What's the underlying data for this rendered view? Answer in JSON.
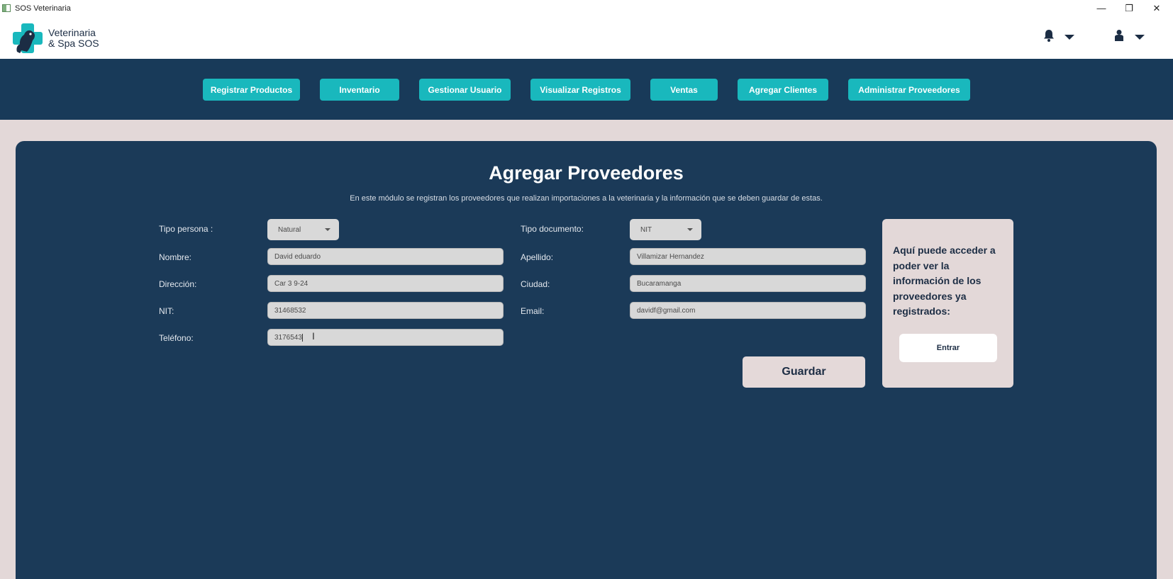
{
  "window": {
    "title": "SOS Veterinaria",
    "controls": {
      "minimize": "—",
      "restore": "❐",
      "close": "✕"
    }
  },
  "header": {
    "logo_line1": "Veterinaria",
    "logo_line2": "& Spa SOS",
    "icons": [
      "bell-icon",
      "user-icon"
    ]
  },
  "nav": {
    "items": [
      "Registrar Productos",
      "Inventario",
      "Gestionar Usuario",
      "Visualizar Registros",
      "Ventas",
      "Agregar Clientes",
      "Administrar Proveedores"
    ]
  },
  "form": {
    "title": "Agregar Proveedores",
    "subtitle": "En este módulo se registran los proveedores que realizan importaciones a la veterinaria y la información que se deben guardar de estas.",
    "tipo_persona": {
      "label": "Tipo persona :",
      "value": "Natural"
    },
    "tipo_documento": {
      "label": "Tipo documento:",
      "value": "NIT"
    },
    "nombre": {
      "label": "Nombre:",
      "value": "David eduardo"
    },
    "apellido": {
      "label": "Apellido:",
      "value": "Villamizar Hernandez"
    },
    "direccion": {
      "label": "Dirección:",
      "value": "Car 3 9-24"
    },
    "ciudad": {
      "label": "Ciudad:",
      "value": "Bucaramanga"
    },
    "nit": {
      "label": "NIT:",
      "value": "31468532"
    },
    "email": {
      "label": "Email:",
      "value": "davidf@gmail.com"
    },
    "telefono": {
      "label": "Teléfono:",
      "value": "3176543"
    },
    "save_label": "Guardar"
  },
  "side_panel": {
    "text": "Aquí puede acceder a poder ver la información de los proveedores ya registrados:",
    "button_label": "Entrar"
  },
  "colors": {
    "nav_bg": "#183a59",
    "panel_bg": "#1b3a58",
    "accent": "#19b8bd",
    "page_bg": "#e3d8d8"
  }
}
